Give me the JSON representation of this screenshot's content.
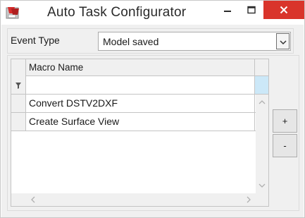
{
  "window": {
    "title": "Auto Task Configurator",
    "icon": "app-icon",
    "controls": {
      "minimize": "minimize-icon",
      "maximize": "maximize-icon",
      "close": "close-icon"
    },
    "close_color": "#d9342b"
  },
  "event": {
    "label": "Event Type",
    "selected": "Model saved"
  },
  "grid": {
    "columns": [
      "Macro Name"
    ],
    "filter_value": "",
    "rows": [
      {
        "macro_name": "Convert DSTV2DXF"
      },
      {
        "macro_name": "Create Surface View"
      }
    ]
  },
  "buttons": {
    "add": "+",
    "remove": "-"
  }
}
